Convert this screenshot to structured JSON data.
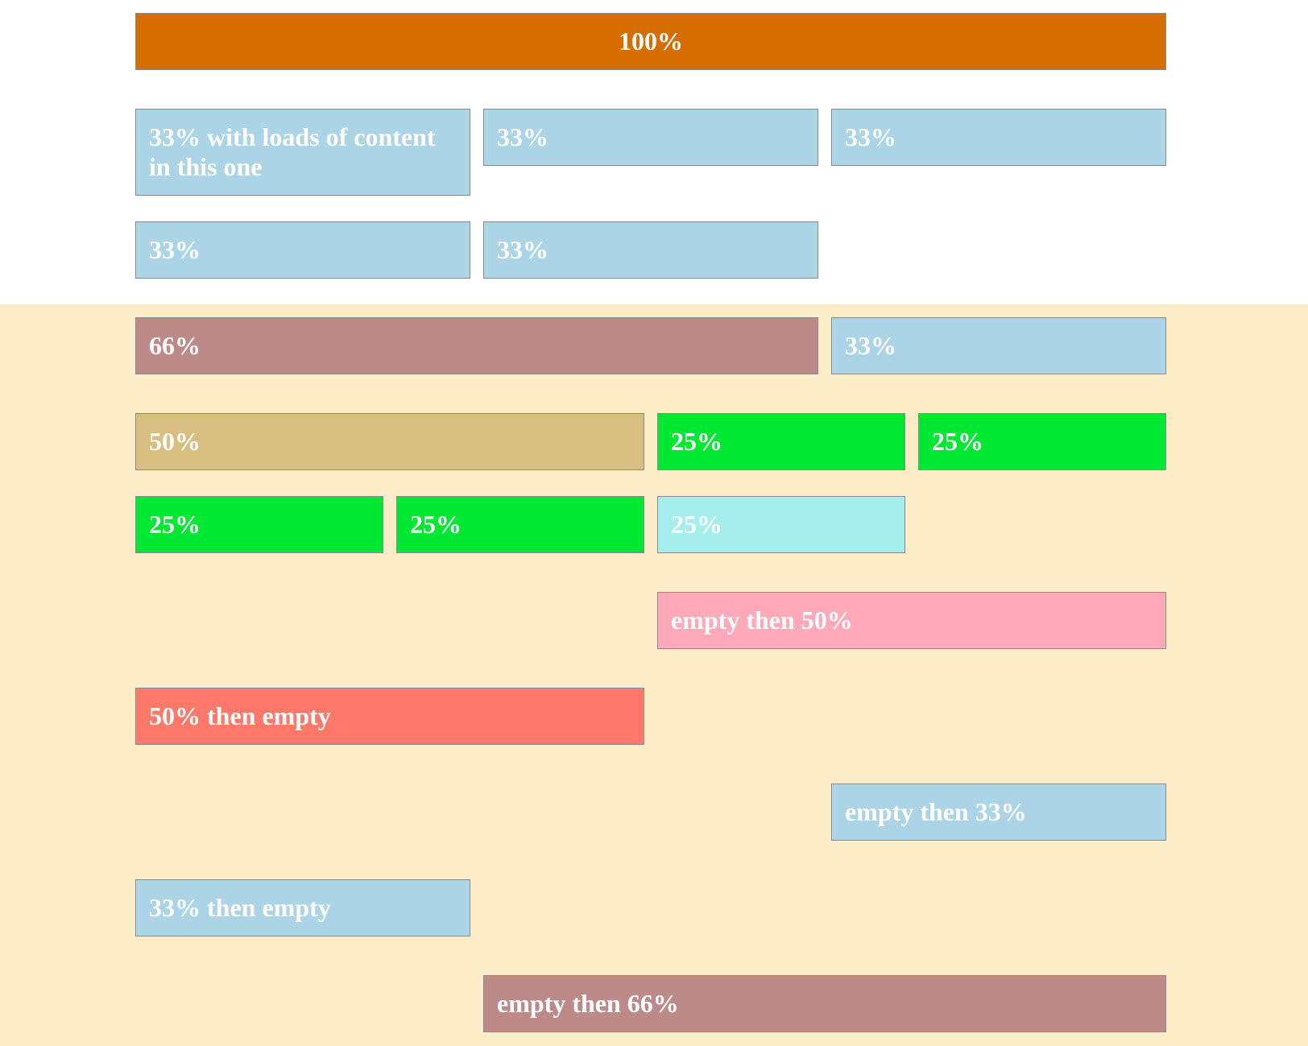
{
  "rows": {
    "r1": {
      "full": "100%"
    },
    "r2": {
      "a": "33% with loads of content in this one",
      "b": "33%",
      "c": "33%"
    },
    "r3": {
      "a": "33%",
      "b": "33%"
    },
    "r4": {
      "a": "66%",
      "b": "33%"
    },
    "r5": {
      "a": "50%",
      "b": "25%",
      "c": "25%"
    },
    "r6": {
      "a": "25%",
      "b": "25%",
      "c": "25%"
    },
    "r7": {
      "a": "empty then 50%"
    },
    "r8": {
      "a": "50% then empty"
    },
    "r9": {
      "a": "empty then 33%"
    },
    "r10": {
      "a": "33% then empty"
    },
    "r11": {
      "a": "empty then 66%"
    }
  },
  "colors": {
    "page_background": "#ffffff",
    "band_background": "#fcedc8",
    "blue": "#abd4e7",
    "orange": "#d56d00",
    "mauve": "#bd8a8a",
    "tan": "#d9be82",
    "green": "#00e831",
    "cyan": "#a6eeee",
    "pink": "#ffa9ba",
    "salmon": "#ff7869"
  }
}
